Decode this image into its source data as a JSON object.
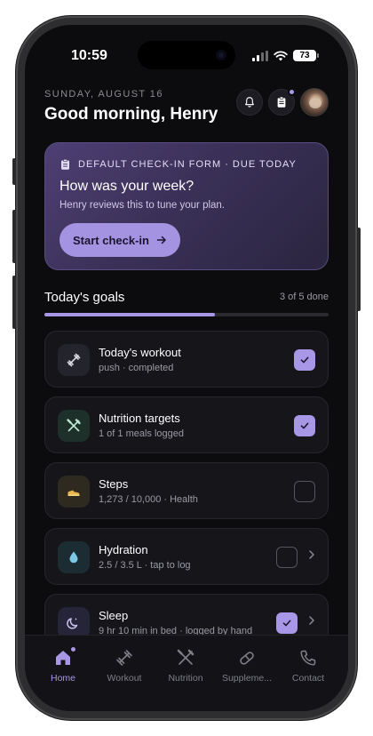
{
  "status": {
    "time": "10:59",
    "battery": "73"
  },
  "header": {
    "date": "SUNDAY, AUGUST 16",
    "greeting": "Good morning, Henry"
  },
  "checkin": {
    "tag": "DEFAULT CHECK-IN FORM · DUE TODAY",
    "title": "How was your week?",
    "subtitle": "Henry reviews this to tune your plan.",
    "button": "Start check-in"
  },
  "goals": {
    "title": "Today's goals",
    "count": "3 of 5 done",
    "progress": 0.6,
    "items": [
      {
        "title": "Today's workout",
        "sub": "push · completed",
        "done": true,
        "icon": "dumbbell-icon"
      },
      {
        "title": "Nutrition targets",
        "sub": "1 of 1 meals logged",
        "done": true,
        "icon": "fork-knife-icon"
      },
      {
        "title": "Steps",
        "sub": "1,273 / 10,000 · Health",
        "done": false,
        "icon": "shoe-icon"
      },
      {
        "title": "Hydration",
        "sub": "2.5 / 3.5 L · tap to log",
        "done": false,
        "icon": "droplet-icon"
      },
      {
        "title": "Sleep",
        "sub": "9 hr 10 min in bed · logged by hand",
        "done": true,
        "icon": "moon-icon"
      }
    ]
  },
  "tabs": [
    {
      "label": "Home",
      "icon": "home-icon",
      "active": true
    },
    {
      "label": "Workout",
      "icon": "dumbbell-icon",
      "active": false
    },
    {
      "label": "Nutrition",
      "icon": "fork-knife-icon",
      "active": false
    },
    {
      "label": "Suppleme...",
      "icon": "pill-icon",
      "active": false
    },
    {
      "label": "Contact",
      "icon": "phone-icon",
      "active": false
    }
  ],
  "colors": {
    "accent": "#a896e6",
    "background": "#0c0c0e",
    "card": "#15151a"
  }
}
